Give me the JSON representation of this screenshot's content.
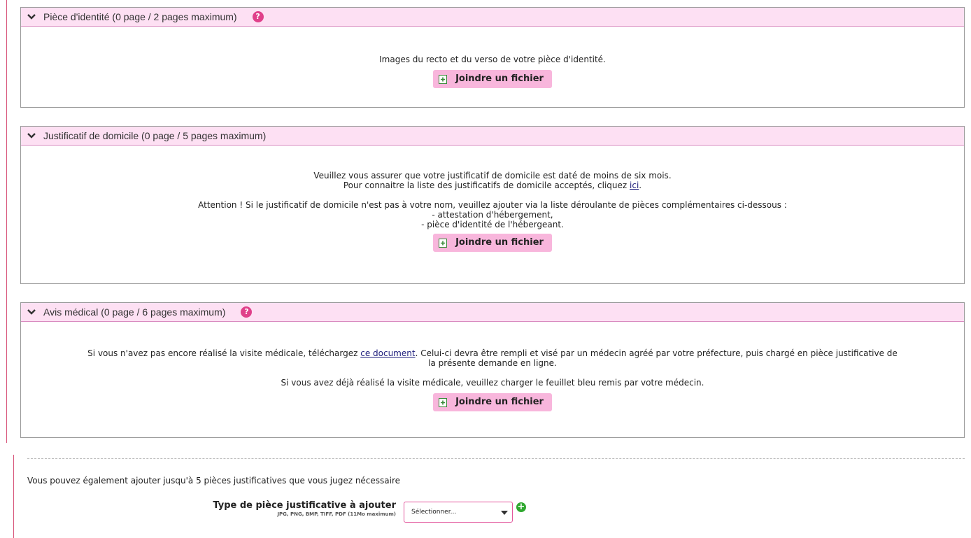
{
  "sections": [
    {
      "title": "Pièce d'identité (0 page / 2 pages maximum)",
      "help_label": "?",
      "lines": [
        "Images du recto et du verso de votre pièce d'identité."
      ],
      "button_label": "Joindre un fichier"
    },
    {
      "title": "Justificatif de domicile (0 page / 5 pages maximum)",
      "line1": "Veuillez vous assurer que votre justificatif de domicile est daté de moins de six mois.",
      "line2_prefix": "Pour connaitre la liste des justificatifs de domicile acceptés, cliquez ",
      "line2_link": "ici",
      "line2_suffix": ".",
      "line3": "Attention ! Si le justificatif de domicile n'est pas à votre nom, veuillez ajouter via la liste déroulante de pièces complémentaires ci-dessous :",
      "line4": "- attestation d'hébergement,",
      "line5": "- pièce d'identité de l'hébergeant.",
      "button_label": "Joindre un fichier"
    },
    {
      "title": "Avis médical (0 page / 6 pages maximum)",
      "help_label": "?",
      "line1_prefix": "Si vous n'avez pas encore réalisé la visite médicale, téléchargez ",
      "line1_link": "ce document",
      "line1_suffix": ". Celui-ci devra être rempli et visé par un médecin agréé par votre préfecture, puis chargé en pièce justificative de",
      "line2": "la présente demande en ligne.",
      "line3": "Si vous avez déjà réalisé la visite médicale, veuillez charger le feuillet bleu remis par votre médecin.",
      "button_label": "Joindre un fichier"
    }
  ],
  "extra": {
    "note": "Vous pouvez également ajouter jusqu'à 5 pièces justificatives que vous jugez nécessaire",
    "type_label": "Type de pièce justificative à ajouter",
    "formats": "JPG, PNG, BMP, TIFF, PDF (11Mo maximum)",
    "select_value": "Sélectionner...",
    "add_label": "+"
  },
  "colors": {
    "header_bg": "#fde0f3",
    "button_bg": "#f8b6dc",
    "help_bg": "#e0408a",
    "add_green": "#2fa82f"
  },
  "icons": {
    "section_toggle": "chevron-down-icon",
    "attach": "file-add-icon",
    "help": "help-icon",
    "add": "plus-circle-icon"
  }
}
